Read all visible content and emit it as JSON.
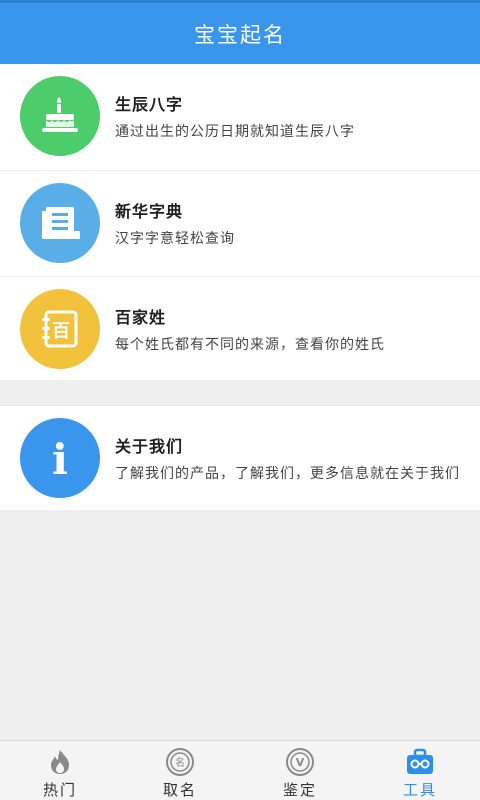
{
  "header": {
    "title": "宝宝起名"
  },
  "list_main": [
    {
      "title": "生辰八字",
      "desc": "通过出生的公历日期就知道生辰八字",
      "icon": "birthday-cake-icon",
      "color": "#4ccc6b"
    },
    {
      "title": "新华字典",
      "desc": "汉字字意轻松查询",
      "icon": "book-icon",
      "color": "#5aaee8"
    },
    {
      "title": "百家姓",
      "desc": "每个姓氏都有不同的来源，查看你的姓氏",
      "icon": "notebook-bai-icon",
      "color": "#f2c23c",
      "icon_glyph": "百"
    }
  ],
  "about": {
    "title": "关于我们",
    "desc": "了解我们的产品，了解我们，更多信息就在关于我们",
    "icon": "info-icon",
    "color": "#3a96ec",
    "icon_glyph": "i"
  },
  "tabs": [
    {
      "label": "热门",
      "icon": "flame-icon",
      "active": false
    },
    {
      "label": "取名",
      "icon": "name-seal-icon",
      "active": false,
      "icon_glyph": "名"
    },
    {
      "label": "鉴定",
      "icon": "verify-icon",
      "active": false,
      "icon_glyph": "V"
    },
    {
      "label": "工具",
      "icon": "toolbox-icon",
      "active": true
    }
  ],
  "colors": {
    "header": "#3a96ec",
    "active_tab": "#2f8fe8"
  }
}
